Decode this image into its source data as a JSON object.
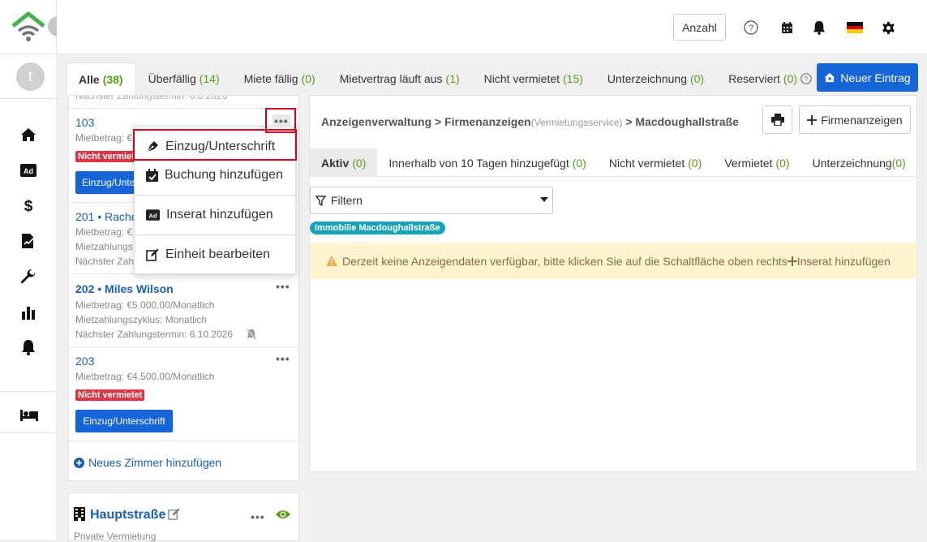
{
  "header": {
    "count_button": "Anzahl"
  },
  "sidebar": {
    "avatar_letter": "t"
  },
  "tabs": [
    {
      "label": "Alle",
      "count": "(38)"
    },
    {
      "label": "Überfällig",
      "count": "(14)"
    },
    {
      "label": "Miete fällig",
      "count": "(0)"
    },
    {
      "label": "Mietvertrag läuft aus",
      "count": "(1)"
    },
    {
      "label": "Nicht vermietet",
      "count": "(15)"
    },
    {
      "label": "Unterzeichnung",
      "count": "(0)"
    },
    {
      "label": "Reserviert",
      "count": "(0)"
    }
  ],
  "new_entry_button": "Neuer Eintrag",
  "units": [
    {
      "number": "103",
      "rent_partial": "Mietbetrag: €",
      "badge_partial": "Nicht vermiet",
      "button_partial": "Einzug/Unter"
    },
    {
      "number": "201 • Rache",
      "rent_partial": "Mietbetrag: €",
      "cycle_partial": "Mietzahlungs",
      "next_partial": "Nächster Zahl"
    },
    {
      "number": "202 • Miles Wilson",
      "rent": "Mietbetrag: €5.000,00/Monatlich",
      "cycle": "Mietzahlungszyklus: Monatlich",
      "next": "Nächster Zahlungstermin:  6.10.2026"
    },
    {
      "number": "203",
      "rent": "Mietbetrag: €4.500,00/Monatlich",
      "badge": "Nicht vermietet",
      "button": "Einzug/Unterschrift"
    }
  ],
  "top_partial": "Nächster Zahlungstermin: 6.8.2026",
  "add_room": "Neues Zimmer hinzufügen",
  "property": {
    "name": "Hauptstraße",
    "subtitle": "Private Vermietung"
  },
  "dropdown": [
    {
      "label": "Einzug/Unterschrift",
      "icon": "pen-nib-icon"
    },
    {
      "label": "Buchung hinzufügen",
      "icon": "calendar-check-icon"
    },
    {
      "label": "Inserat hinzufügen",
      "icon": "ad-icon"
    },
    {
      "label": "Einheit bearbeiten",
      "icon": "edit-icon"
    }
  ],
  "breadcrumb": {
    "part1": "Anzeigenverwaltung",
    "sep": ">",
    "part2": "Firmenanzeigen",
    "part2_small": "(Vermietungsservice)",
    "part3": "Macdoughallstraße"
  },
  "firm_button": "Firmenanzeigen",
  "subtabs": [
    {
      "label": "Aktiv",
      "count": "(0)"
    },
    {
      "label": "Innerhalb von 10 Tagen hinzugefügt",
      "count": "(0)"
    },
    {
      "label": "Nicht vermietet",
      "count": "(0)"
    },
    {
      "label": "Vermietet",
      "count": "(0)"
    },
    {
      "label": "Unterzeichnung",
      "count": "(0)"
    }
  ],
  "filter": "Filtern",
  "tag": "Immobilie Macdoughallstraße",
  "warning": "Derzeit keine Anzeigendaten verfügbar, bitte klicken Sie auf die Schaltfläche oben rechts",
  "warning_link": "Inserat hinzufügen",
  "colors": {
    "primary": "#1565d8",
    "green": "#5c9a1e",
    "red": "#dc3545",
    "teal": "#17a2b8",
    "highlight": "#d0021b"
  }
}
